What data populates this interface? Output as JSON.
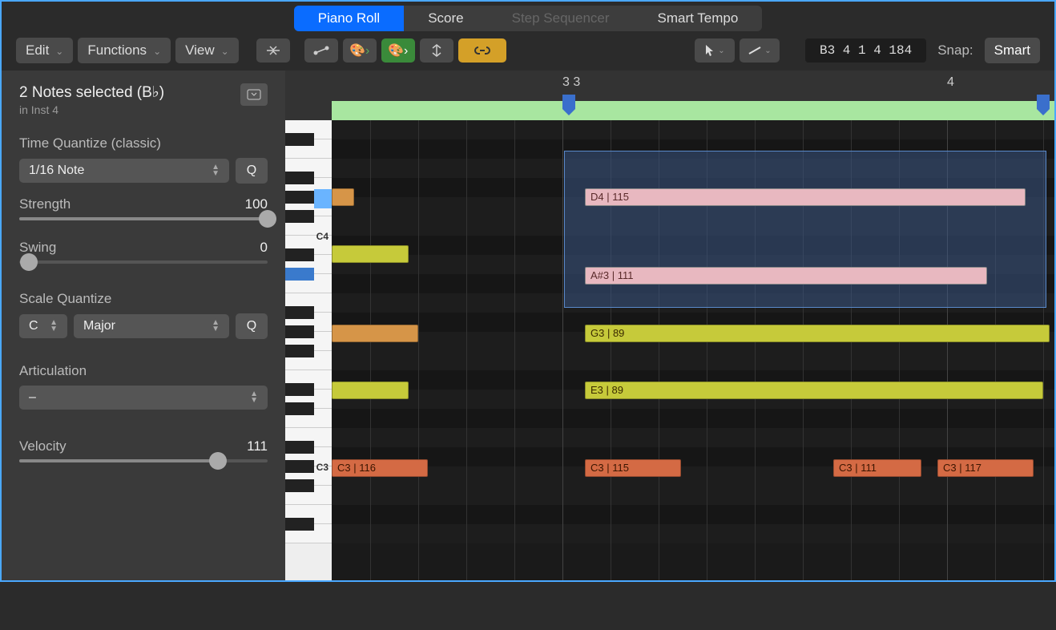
{
  "tabs": {
    "piano_roll": "Piano Roll",
    "score": "Score",
    "step_sequencer": "Step Sequencer",
    "smart_tempo": "Smart Tempo"
  },
  "toolbar": {
    "edit": "Edit",
    "functions": "Functions",
    "view": "View",
    "info_display": "B3   4 1 4 184",
    "snap_label": "Snap:",
    "snap_value": "Smart"
  },
  "inspector": {
    "title": "2 Notes selected (B♭)",
    "subtitle": "in Inst 4",
    "time_quantize_label": "Time Quantize (classic)",
    "time_quantize_value": "1/16 Note",
    "q_button": "Q",
    "strength_label": "Strength",
    "strength_value": "100",
    "swing_label": "Swing",
    "swing_value": "0",
    "scale_quantize_label": "Scale Quantize",
    "scale_root": "C",
    "scale_type": "Major",
    "articulation_label": "Articulation",
    "articulation_value": "–",
    "velocity_label": "Velocity",
    "velocity_value": "111"
  },
  "ruler": {
    "marker1": "3 3",
    "marker2": "4"
  },
  "keyboard": {
    "c4_label": "C4",
    "c3_label": "C3"
  },
  "notes": {
    "d4": "D4 | 115",
    "as3": "A#3 | 111",
    "g3": "G3 | 89",
    "e3": "E3 | 89",
    "c3_a": "C3 | 116",
    "c3_b": "C3 | 115",
    "c3_c": "C3 | 111",
    "c3_d": "C3 | 117"
  },
  "colors": {
    "selected_note": "#e8b8c0",
    "yellow_note": "#c6ca3a",
    "orange_note": "#d69548",
    "red_note": "#d46a44",
    "selection": "rgba(60,90,140,0.5)",
    "active_tab": "#0a6cff"
  }
}
